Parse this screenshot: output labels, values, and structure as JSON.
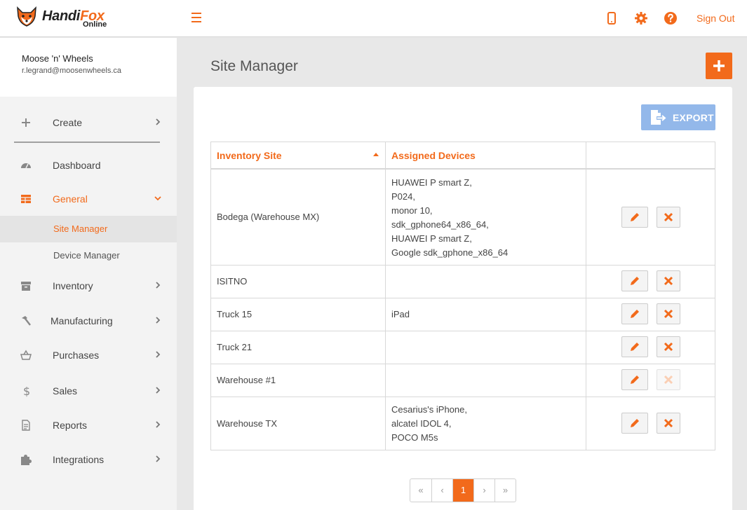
{
  "app": {
    "logo_name_a": "Handi",
    "logo_name_b": "Fox",
    "logo_sub": "Online",
    "brand_color": "#f26a1b"
  },
  "topbar": {
    "icons": [
      "menu-icon",
      "mobile-device-icon",
      "gear-icon",
      "help-icon"
    ],
    "signout_label": "Sign Out"
  },
  "user": {
    "name": "Moose 'n' Wheels",
    "email": "r.legrand@moosenwheels.ca"
  },
  "sidebar": {
    "create_label": "Create",
    "items": [
      {
        "label": "Dashboard",
        "icon": "dashboard-icon"
      },
      {
        "label": "General",
        "icon": "table-icon",
        "expanded": true
      },
      {
        "label": "Inventory",
        "icon": "box-icon"
      },
      {
        "label": "Manufacturing",
        "icon": "hammer-icon"
      },
      {
        "label": "Purchases",
        "icon": "basket-icon"
      },
      {
        "label": "Sales",
        "icon": "dollar-icon"
      },
      {
        "label": "Reports",
        "icon": "report-icon"
      },
      {
        "label": "Integrations",
        "icon": "puzzle-icon"
      }
    ],
    "general_sub": [
      {
        "label": "Site Manager",
        "selected": true
      },
      {
        "label": "Device Manager",
        "selected": false
      }
    ]
  },
  "main": {
    "title": "Site Manager",
    "export_label": "EXPORT",
    "table": {
      "headers": [
        "Inventory Site",
        "Assigned Devices",
        ""
      ],
      "sort": "ascending",
      "rows": [
        {
          "site": "Bodega (Warehouse MX)",
          "devices": [
            "HUAWEI P smart Z,",
            "P024,",
            "monor 10,",
            "sdk_gphone64_x86_64,",
            "HUAWEI P smart Z,",
            "Google sdk_gphone_x86_64"
          ],
          "delete_enabled": true
        },
        {
          "site": "ISITNO",
          "devices": [],
          "delete_enabled": true
        },
        {
          "site": "Truck 15",
          "devices": [
            "iPad"
          ],
          "delete_enabled": true
        },
        {
          "site": "Truck 21",
          "devices": [],
          "delete_enabled": true
        },
        {
          "site": "Warehouse #1",
          "devices": [],
          "delete_enabled": false
        },
        {
          "site": "Warehouse TX",
          "devices": [
            "Cesarius's iPhone,",
            "alcatel IDOL 4,",
            "POCO M5s"
          ],
          "delete_enabled": true
        }
      ]
    },
    "pagination": {
      "first": "«",
      "prev": "‹",
      "current": "1",
      "next": "›",
      "last": "»"
    }
  }
}
